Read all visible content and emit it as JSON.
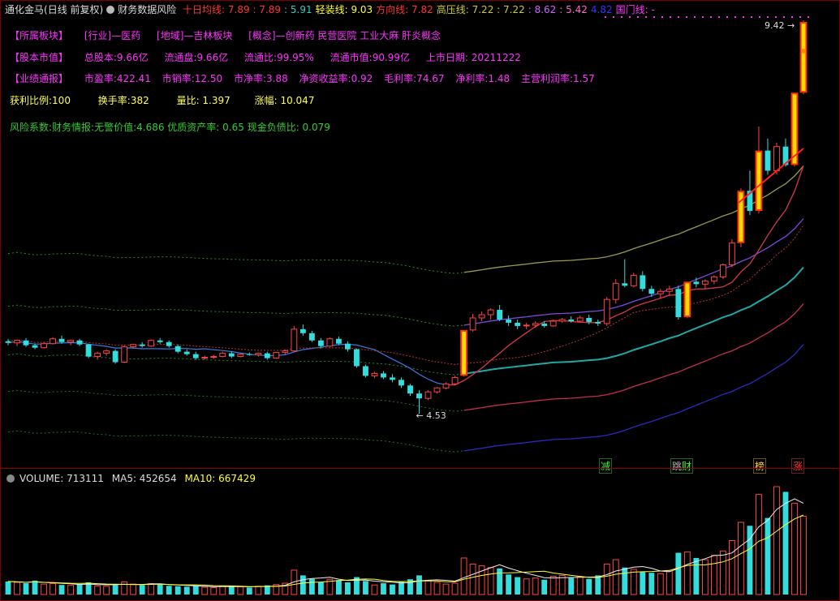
{
  "header": {
    "stock_name": "通化金马",
    "period": "(日线 前复权)",
    "indicator": "财务数据风险",
    "items": [
      {
        "label": "十日均线:",
        "text": "7.89 : 7.89",
        "color": "#ff3333"
      },
      {
        "label": "",
        "text": ": 5.91",
        "color": "#33cccc"
      },
      {
        "label": "轻装线:",
        "text": "9.03",
        "color": "#ffff33"
      },
      {
        "label": "方向线:",
        "text": "7.82",
        "color": "#ff3333"
      },
      {
        "label": "高压线:",
        "text": "7.22 : 7.22",
        "color": "#cccc33"
      },
      {
        "label": "",
        "text": ": 8.62",
        "color": "#cc66ff"
      },
      {
        "label": "",
        "text": ": 5.42",
        "color": "#ff66cc"
      },
      {
        "label": "",
        "text": "4.82",
        "color": "#3333ff"
      },
      {
        "label": "国门线:",
        "text": "-",
        "color": "#ff33ff"
      }
    ]
  },
  "info": {
    "row1": [
      "【所属板块】",
      "[行业]—医药",
      "[地域]—吉林板块",
      "[概念]—创新药 民营医院 工业大麻 肝炎概念"
    ],
    "row2": [
      "【股本市值】",
      "总股本:9.66亿",
      "流通盘:9.66亿",
      "流通比:99.95%",
      "流通市值:90.99亿",
      "上市日期: 20211222"
    ],
    "row3": [
      "【业绩通报】",
      "市盈率:422.41",
      "市销率:12.50",
      "市净率:3.88",
      "净资收益率:0.92",
      "毛利率:74.67",
      "净利率:1.48",
      "主营利润率:1.57"
    ],
    "row4": [
      "获利比例:100",
      "换手率:382",
      "量比: 1.397",
      "涨幅: 10.047"
    ],
    "row5": "风险系数:财务情报:无警价值:4.686 优质资产率: 0.65 现金负债比: 0.079"
  },
  "price_labels": {
    "high": "9.42",
    "low": "4.53"
  },
  "signals": [
    {
      "text": "减",
      "color": "#33ff33"
    },
    {
      "text": "财",
      "color": "#33ff33"
    },
    {
      "text": "榜",
      "color": "#ffcc33"
    },
    {
      "text": "涨",
      "color": "#ff3333"
    }
  ],
  "volume": {
    "label": "VOLUME: 713111",
    "ma5": "MA5: 452654",
    "ma10": "MA10: 667429"
  },
  "chart_data": {
    "type": "candlestick",
    "title": "通化金马 (日线 前复权)",
    "price_range": [
      4.53,
      9.42
    ],
    "ohlc": [
      [
        5.43,
        5.46,
        5.38,
        5.41
      ],
      [
        5.41,
        5.45,
        5.37,
        5.44
      ],
      [
        5.44,
        5.47,
        5.36,
        5.38
      ],
      [
        5.38,
        5.4,
        5.33,
        5.35
      ],
      [
        5.35,
        5.42,
        5.34,
        5.4
      ],
      [
        5.4,
        5.48,
        5.39,
        5.46
      ],
      [
        5.46,
        5.5,
        5.4,
        5.42
      ],
      [
        5.42,
        5.45,
        5.38,
        5.44
      ],
      [
        5.44,
        5.46,
        5.37,
        5.39
      ],
      [
        5.39,
        5.4,
        5.22,
        5.24
      ],
      [
        5.24,
        5.3,
        5.2,
        5.28
      ],
      [
        5.28,
        5.33,
        5.25,
        5.31
      ],
      [
        5.31,
        5.33,
        5.15,
        5.17
      ],
      [
        5.17,
        5.38,
        5.16,
        5.36
      ],
      [
        5.36,
        5.4,
        5.34,
        5.39
      ],
      [
        5.39,
        5.42,
        5.35,
        5.37
      ],
      [
        5.37,
        5.45,
        5.36,
        5.44
      ],
      [
        5.44,
        5.47,
        5.4,
        5.42
      ],
      [
        5.42,
        5.44,
        5.35,
        5.37
      ],
      [
        5.37,
        5.39,
        5.28,
        5.3
      ],
      [
        5.3,
        5.33,
        5.25,
        5.27
      ],
      [
        5.27,
        5.3,
        5.2,
        5.22
      ],
      [
        5.22,
        5.25,
        5.2,
        5.23
      ],
      [
        5.23,
        5.26,
        5.21,
        5.24
      ],
      [
        5.24,
        5.3,
        5.23,
        5.28
      ],
      [
        5.28,
        5.3,
        5.22,
        5.24
      ],
      [
        5.24,
        5.28,
        5.23,
        5.27
      ],
      [
        5.27,
        5.29,
        5.25,
        5.26
      ],
      [
        5.26,
        5.29,
        5.24,
        5.28
      ],
      [
        5.28,
        5.3,
        5.2,
        5.22
      ],
      [
        5.22,
        5.3,
        5.21,
        5.29
      ],
      [
        5.29,
        5.33,
        5.27,
        5.31
      ],
      [
        5.31,
        5.62,
        5.3,
        5.58
      ],
      [
        5.58,
        5.64,
        5.5,
        5.53
      ],
      [
        5.53,
        5.56,
        5.42,
        5.44
      ],
      [
        5.44,
        5.47,
        5.34,
        5.37
      ],
      [
        5.37,
        5.48,
        5.36,
        5.46
      ],
      [
        5.46,
        5.49,
        5.38,
        5.4
      ],
      [
        5.4,
        5.43,
        5.3,
        5.33
      ],
      [
        5.33,
        5.34,
        5.1,
        5.12
      ],
      [
        5.12,
        5.14,
        4.98,
        5.0
      ],
      [
        5.0,
        5.05,
        4.97,
        5.03
      ],
      [
        5.03,
        5.06,
        4.96,
        4.98
      ],
      [
        4.98,
        5.02,
        4.92,
        4.95
      ],
      [
        4.95,
        4.98,
        4.85,
        4.88
      ],
      [
        4.88,
        4.9,
        4.75,
        4.78
      ],
      [
        4.78,
        4.82,
        4.53,
        4.72
      ],
      [
        4.72,
        4.82,
        4.7,
        4.8
      ],
      [
        4.8,
        4.86,
        4.78,
        4.85
      ],
      [
        4.85,
        4.92,
        4.83,
        4.9
      ],
      [
        4.9,
        5.0,
        4.89,
        4.98
      ],
      [
        5.0,
        5.57,
        4.99,
        5.57
      ],
      [
        5.57,
        5.77,
        5.55,
        5.72
      ],
      [
        5.72,
        5.8,
        5.68,
        5.76
      ],
      [
        5.76,
        5.84,
        5.7,
        5.82
      ],
      [
        5.82,
        5.88,
        5.68,
        5.7
      ],
      [
        5.7,
        5.75,
        5.62,
        5.66
      ],
      [
        5.66,
        5.7,
        5.58,
        5.62
      ],
      [
        5.62,
        5.66,
        5.58,
        5.63
      ],
      [
        5.63,
        5.68,
        5.6,
        5.65
      ],
      [
        5.65,
        5.68,
        5.6,
        5.62
      ],
      [
        5.62,
        5.7,
        5.61,
        5.68
      ],
      [
        5.68,
        5.72,
        5.66,
        5.7
      ],
      [
        5.7,
        5.74,
        5.66,
        5.68
      ],
      [
        5.68,
        5.75,
        5.67,
        5.72
      ],
      [
        5.72,
        5.76,
        5.64,
        5.67
      ],
      [
        5.67,
        5.7,
        5.62,
        5.65
      ],
      [
        5.65,
        5.98,
        5.62,
        5.95
      ],
      [
        5.95,
        6.2,
        5.9,
        6.15
      ],
      [
        6.15,
        6.45,
        6.1,
        6.12
      ],
      [
        6.12,
        6.28,
        6.1,
        6.25
      ],
      [
        6.25,
        6.3,
        6.05,
        6.08
      ],
      [
        6.08,
        6.12,
        5.98,
        6.02
      ],
      [
        6.02,
        6.08,
        5.96,
        6.05
      ],
      [
        6.05,
        6.12,
        6.0,
        6.08
      ],
      [
        6.08,
        6.12,
        5.7,
        5.73
      ],
      [
        5.73,
        6.17,
        5.72,
        6.17
      ],
      [
        6.17,
        6.22,
        6.1,
        6.14
      ],
      [
        6.14,
        6.2,
        6.08,
        6.18
      ],
      [
        6.18,
        6.25,
        6.14,
        6.23
      ],
      [
        6.23,
        6.4,
        6.2,
        6.38
      ],
      [
        6.38,
        6.7,
        6.35,
        6.65
      ],
      [
        6.65,
        7.33,
        6.6,
        7.3
      ],
      [
        7.3,
        7.55,
        7.0,
        7.05
      ],
      [
        7.05,
        8.1,
        7.02,
        7.8
      ],
      [
        7.8,
        7.95,
        7.5,
        7.55
      ],
      [
        7.55,
        7.9,
        7.5,
        7.85
      ],
      [
        7.85,
        7.95,
        7.6,
        7.62
      ],
      [
        7.62,
        8.52,
        7.6,
        8.52
      ],
      [
        8.52,
        9.42,
        8.5,
        9.4
      ]
    ],
    "ma_lines": [
      "十日均线",
      "轻装线",
      "方向线",
      "高压线",
      "国门线"
    ],
    "volume": [
      150,
      140,
      130,
      160,
      120,
      125,
      110,
      105,
      120,
      140,
      100,
      95,
      110,
      145,
      120,
      110,
      125,
      115,
      100,
      95,
      90,
      100,
      85,
      80,
      95,
      100,
      90,
      80,
      95,
      105,
      115,
      130,
      280,
      220,
      180,
      140,
      175,
      165,
      140,
      200,
      155,
      110,
      130,
      115,
      150,
      175,
      220,
      160,
      140,
      120,
      130,
      420,
      350,
      330,
      310,
      300,
      230,
      200,
      180,
      190,
      170,
      210,
      220,
      190,
      200,
      180,
      220,
      350,
      400,
      310,
      290,
      260,
      250,
      240,
      270,
      480,
      490,
      420,
      400,
      450,
      500,
      620,
      830,
      790,
      1150,
      880,
      1240,
      1180,
      1050,
      900
    ],
    "volume_max": 1240
  }
}
